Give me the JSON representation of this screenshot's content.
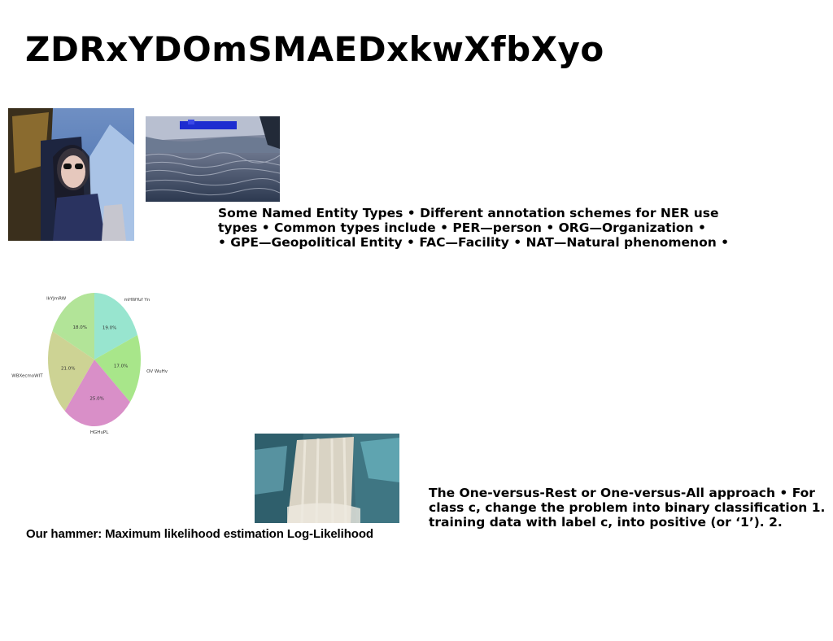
{
  "slide": {
    "title": "ZDRxYDOmSMAEDxkwXfbXyo",
    "ner_lines": [
      "Some Named Entity Types • Different annotation schemes for NER use",
      "types • Common types include • PER—person • ORG—Organization •",
      "• GPE—Geopolitical Entity • FAC—Facility • NAT—Natural phenomenon •"
    ],
    "ovr_lines": [
      "The One-versus-Rest or One-versus-All approach • For",
      "class c, change the problem into binary classification 1.",
      "training data with label c, into positive (or ‘1’). 2."
    ],
    "caption": "Our hammer: Maximum likelihood estimation Log-Likelihood"
  },
  "images": {
    "woman": "photo of woman in sunglasses in car",
    "water": "photo of rippled water",
    "falls": "photo of waterfall"
  },
  "chart_data": {
    "type": "pie",
    "labels": [
      "mHWYuf Yn",
      "OV WuHv",
      "HGHuPL",
      "WBXecmoWIT",
      "lkYJmRW"
    ],
    "values": [
      19.0,
      17.0,
      25.0,
      21.0,
      18.0
    ],
    "value_labels": [
      "19.0%",
      "17.0%",
      "25.0%",
      "21.0%",
      "18.0%"
    ],
    "colors": [
      "#98e5cf",
      "#a8e68a",
      "#d98fc8",
      "#cdd394",
      "#b2e498"
    ],
    "start_angle_deg": 90,
    "direction": "clockwise"
  }
}
